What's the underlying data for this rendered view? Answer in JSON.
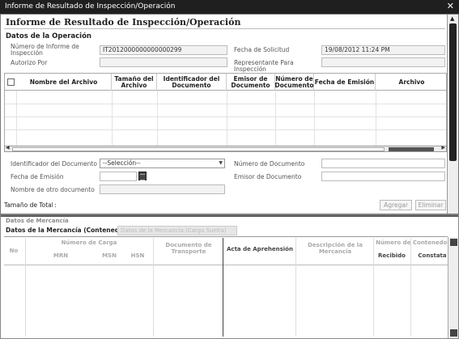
{
  "window": {
    "title": "Informe de Resultado de Inspección/Operación",
    "close_glyph": "✕"
  },
  "dialog": {
    "title": "Informe de Resultado de Inspección/Operación",
    "section": "Datos de la Operación",
    "fields": {
      "numero_informe_label": "Número de Informe de Inspección",
      "numero_informe_value": "IT2012000000000000299",
      "fecha_solicitud_label": "Fecha de Solicitud",
      "fecha_solicitud_value": "19/08/2012 11:24 PM",
      "autorizo_label": "Autorizo Por",
      "autorizo_value": "",
      "representante_label": "Representante Para Inspección",
      "representante_value": ""
    },
    "files_table": {
      "columns": [
        "Nombre del Archivo",
        "Tamaño del Archivo",
        "Identificador del Documento",
        "Emisor de Documento",
        "Número de Documento",
        "Fecha de Emisión",
        "Archivo"
      ]
    },
    "form": {
      "identificador_label": "Identificador del Documento",
      "identificador_selected": "--Selección--",
      "numero_doc_label": "Número de Documento",
      "fecha_emision_label": "Fecha de Emisión",
      "emisor_label": "Emisor de Documento",
      "otro_doc_label": "Nombre de otro documento",
      "total_label": "Tamaño de Total",
      "total_sep": ":",
      "agregar": "Agregar",
      "eliminar": "Eliminar"
    }
  },
  "background": {
    "heading": "Datos de Mercancía",
    "tab_active": "Datos de la Mercancía (Contenedor)",
    "tab_inactive": "Datos de la Mercancía (Carga Suelta)",
    "columns": {
      "no": "No",
      "numero_carga": "Número de Carga",
      "mrn": "MRN",
      "msn": "MSN",
      "hsn": "HSN",
      "doc_transporte": "Documento de Transporte",
      "acta": "Acta de Aprehensión",
      "descripcion": "Descripción de la Mercancía",
      "numero_contenedor": "Número de Contenedor",
      "recibido": "Recibido",
      "constata": "Constata"
    }
  }
}
